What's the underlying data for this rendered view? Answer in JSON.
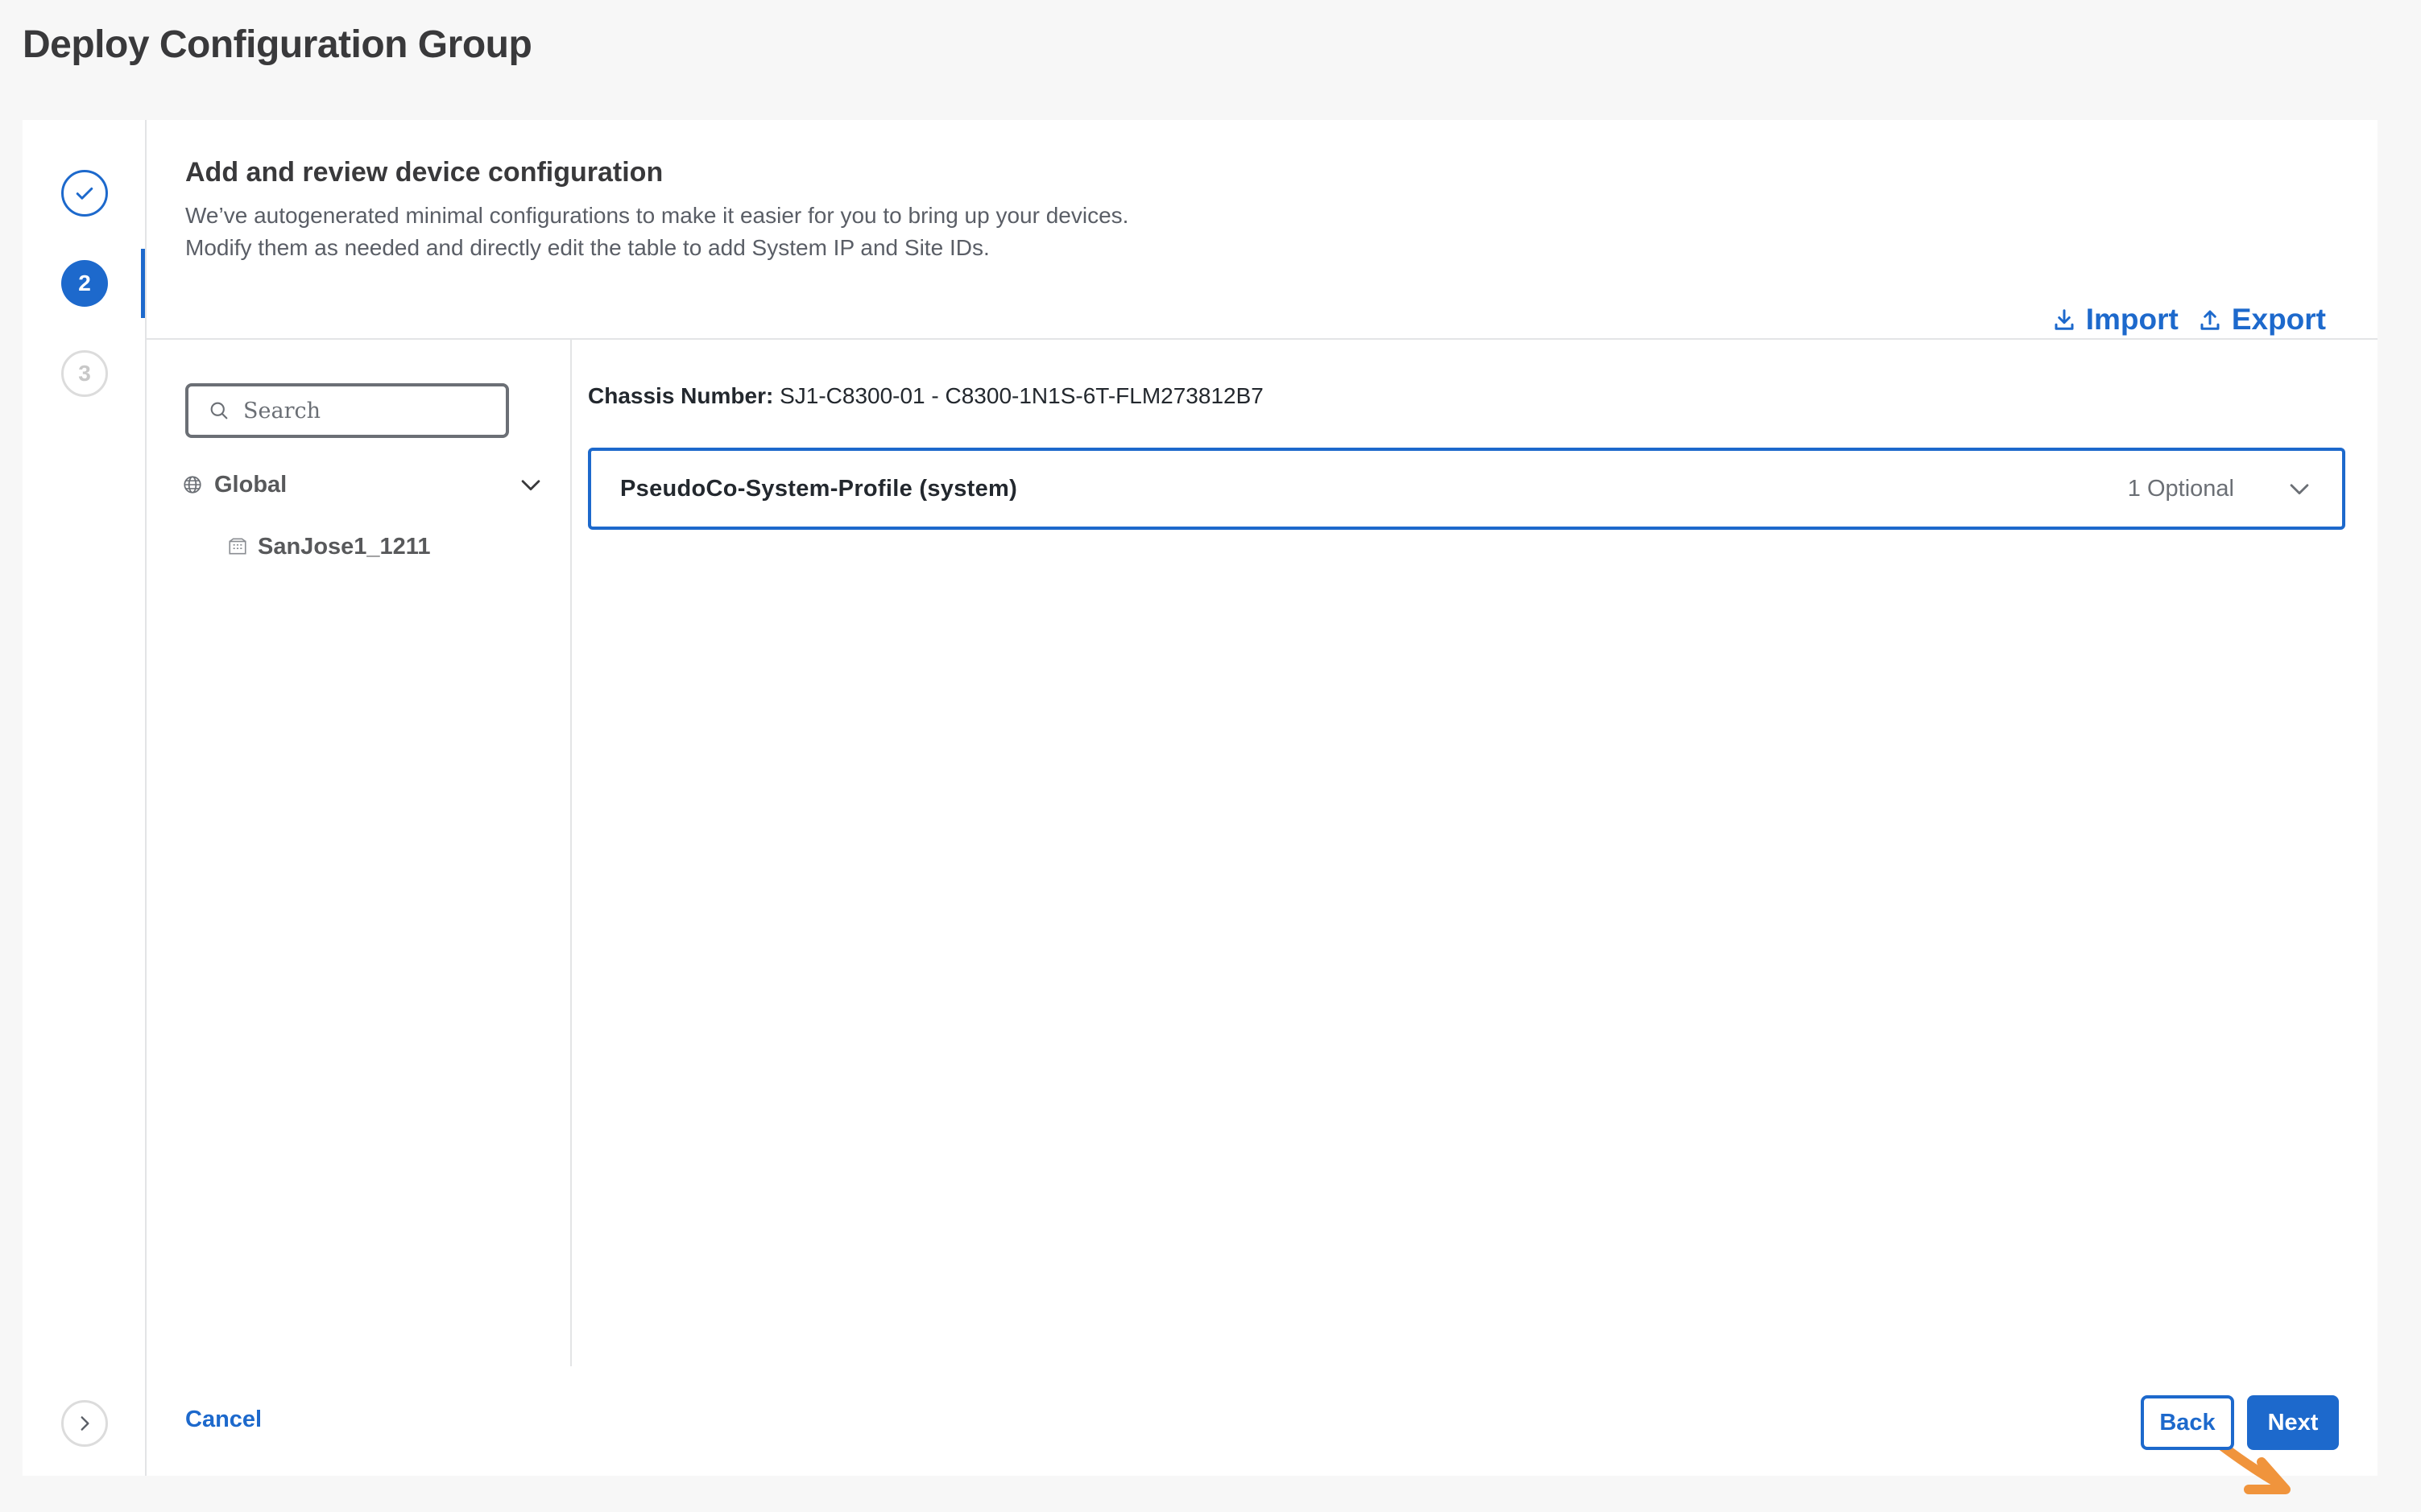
{
  "page": {
    "title": "Deploy Configuration Group"
  },
  "stepper": {
    "steps": [
      {
        "label": "",
        "state": "completed",
        "icon": "check-icon"
      },
      {
        "label": "2",
        "state": "active"
      },
      {
        "label": "3",
        "state": "pending"
      }
    ],
    "expand_icon": "chevron-right-icon"
  },
  "header": {
    "title": "Add and review device configuration",
    "description_line1": "We’ve autogenerated minimal configurations to make it easier for you to bring up your devices.",
    "description_line2": "Modify them as needed and directly edit the table to add System IP and Site IDs."
  },
  "actions": {
    "import_label": "Import",
    "import_icon": "download-icon",
    "export_label": "Export",
    "export_icon": "upload-icon"
  },
  "tree": {
    "search_placeholder": "Search",
    "root": {
      "label": "Global",
      "icon": "globe-icon",
      "expanded": true
    },
    "children": [
      {
        "label": "SanJose1_1211",
        "icon": "building-icon"
      }
    ]
  },
  "main": {
    "chassis_label": "Chassis Number:",
    "chassis_value": "SJ1-C8300-01 - C8300-1N1S-6T-FLM273812B7",
    "profile": {
      "name": "PseudoCo-System-Profile (system)",
      "optional": "1 Optional",
      "icon": "chevron-down-icon"
    }
  },
  "footer": {
    "cancel_label": "Cancel",
    "back_label": "Back",
    "next_label": "Next"
  },
  "colors": {
    "accent": "#1d69cc",
    "annotation_arrow": "#f0943c",
    "background": "#f7f7f7"
  }
}
